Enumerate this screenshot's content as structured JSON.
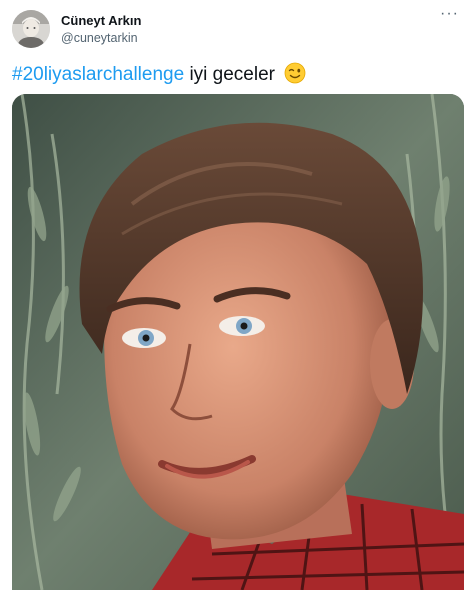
{
  "author": {
    "display_name": "Cüneyt Arkın",
    "handle": "@cuneytarkin",
    "avatar_icon": "profile-photo"
  },
  "menu": {
    "more_label": "···"
  },
  "tweet": {
    "hashtag": "#20liyaslarchallenge",
    "text": "iyi geceler",
    "emoji": "winking-face",
    "link_color": "#1d9bf0"
  },
  "media": {
    "description_icon": "portrait-photo"
  }
}
